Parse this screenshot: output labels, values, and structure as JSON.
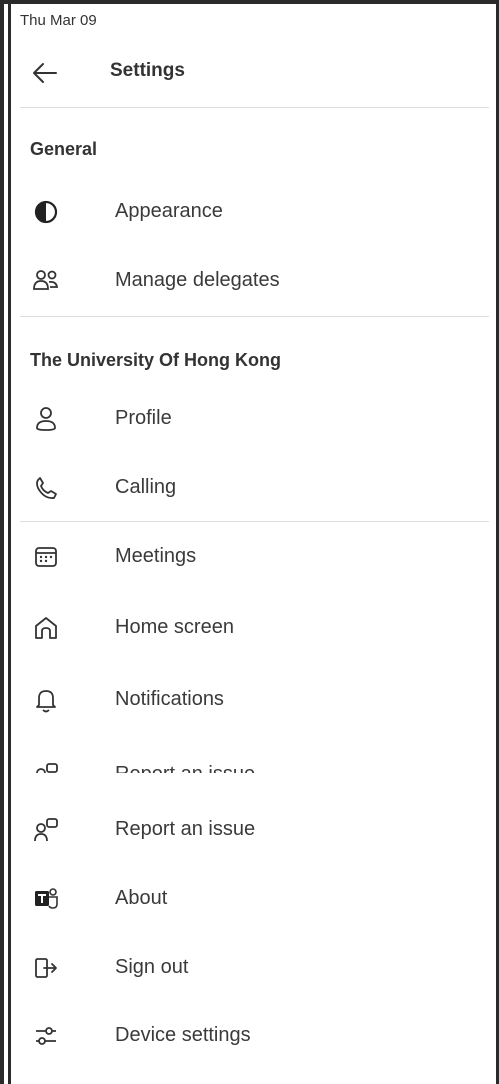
{
  "status_bar": {
    "date": "Thu Mar 09"
  },
  "header": {
    "title": "Settings"
  },
  "general": {
    "heading": "General",
    "items": [
      {
        "label": "Appearance",
        "icon": "contrast-icon"
      },
      {
        "label": "Manage delegates",
        "icon": "people-icon"
      }
    ]
  },
  "org": {
    "heading": "The University Of Hong Kong",
    "items": [
      {
        "label": "Profile",
        "icon": "person-icon"
      },
      {
        "label": "Calling",
        "icon": "phone-icon"
      }
    ]
  },
  "more": {
    "items": [
      {
        "label": "Meetings",
        "icon": "calendar-icon"
      },
      {
        "label": "Home screen",
        "icon": "home-icon"
      },
      {
        "label": "Notifications",
        "icon": "bell-icon"
      },
      {
        "label": "Report an issue",
        "icon": "person-feedback-icon"
      },
      {
        "label": "Report an issue",
        "icon": "person-feedback-icon"
      },
      {
        "label": "About",
        "icon": "teams-logo-icon"
      },
      {
        "label": "Sign out",
        "icon": "sign-out-icon"
      },
      {
        "label": "Device settings",
        "icon": "sliders-icon"
      }
    ]
  }
}
